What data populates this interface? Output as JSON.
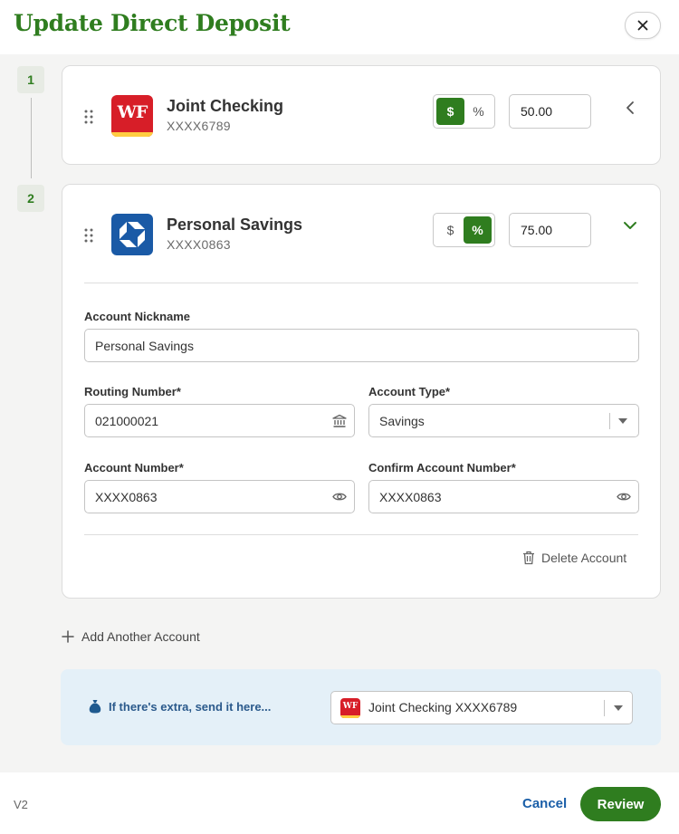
{
  "header": {
    "title": "Update Direct Deposit"
  },
  "steps": [
    "1",
    "2"
  ],
  "accounts": [
    {
      "name": "Joint Checking",
      "number": "XXXX6789",
      "logo_text": "WF",
      "mode": "$",
      "toggle_dollar": "$",
      "toggle_percent": "%",
      "amount": "50.00",
      "expanded": false
    },
    {
      "name": "Personal Savings",
      "number": "XXXX0863",
      "mode": "%",
      "toggle_dollar": "$",
      "toggle_percent": "%",
      "amount": "75.00",
      "expanded": true,
      "form": {
        "nickname_label": "Account Nickname",
        "nickname_value": "Personal Savings",
        "routing_label": "Routing Number*",
        "routing_value": "021000021",
        "type_label": "Account Type*",
        "type_value": "Savings",
        "account_label": "Account Number*",
        "account_value": "XXXX0863",
        "confirm_label": "Confirm Account Number*",
        "confirm_value": "XXXX0863",
        "delete_label": "Delete Account"
      }
    }
  ],
  "add_account_label": "Add Another Account",
  "extra": {
    "label": "If there's extra, send it here...",
    "selected": "Joint Checking XXXX6789",
    "logo_text": "WF"
  },
  "footer": {
    "version": "V2",
    "cancel_label": "Cancel",
    "review_label": "Review"
  },
  "colors": {
    "brand_green": "#2f7d1f",
    "link_blue": "#1b5fa8",
    "wells_red": "#d71e28",
    "wells_gold": "#ffcd41",
    "chase_blue": "#1a5aa6",
    "info_bg": "#e4f0f8"
  }
}
